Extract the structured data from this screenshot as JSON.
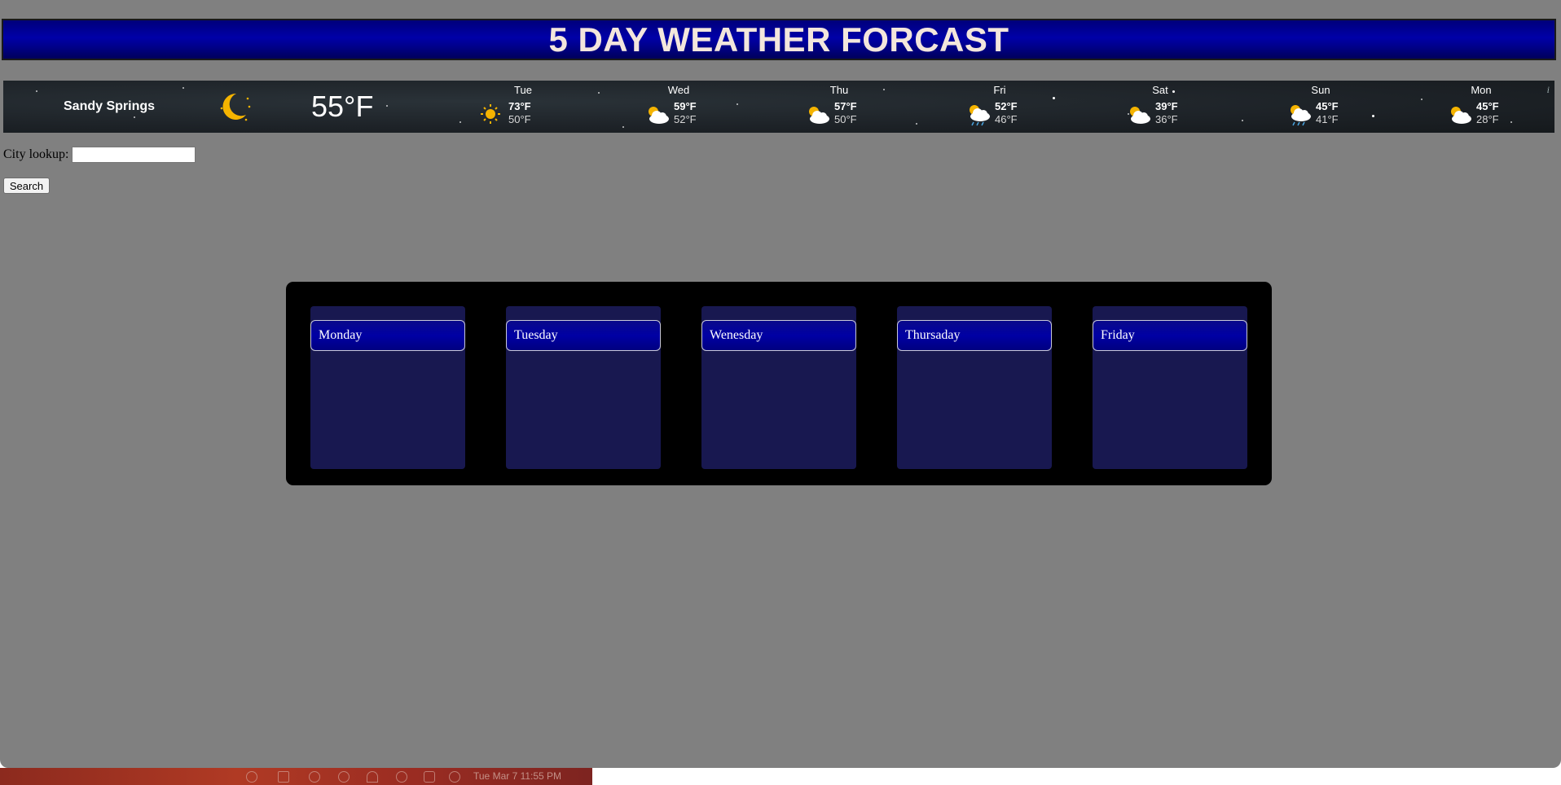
{
  "header": {
    "title": "5 DAY WEATHER FORCAST"
  },
  "widget": {
    "city": "Sandy Springs",
    "current_icon": "moon-icon",
    "current_temp": "55°F",
    "info": "i",
    "days": [
      {
        "name": "Tue",
        "icon": "sun-icon",
        "high": "73°F",
        "low": "50°F"
      },
      {
        "name": "Wed",
        "icon": "partly-cloudy-icon",
        "high": "59°F",
        "low": "52°F"
      },
      {
        "name": "Thu",
        "icon": "partly-cloudy-icon",
        "high": "57°F",
        "low": "50°F"
      },
      {
        "name": "Fri",
        "icon": "rain-icon",
        "high": "52°F",
        "low": "46°F"
      },
      {
        "name": "Sat",
        "icon": "partly-cloudy-icon",
        "high": "39°F",
        "low": "36°F"
      },
      {
        "name": "Sun",
        "icon": "rain-icon",
        "high": "45°F",
        "low": "41°F"
      },
      {
        "name": "Mon",
        "icon": "partly-cloudy-icon",
        "high": "45°F",
        "low": "28°F"
      }
    ]
  },
  "lookup": {
    "label": "City lookup:",
    "value": "",
    "placeholder": ""
  },
  "search": {
    "label": "Search"
  },
  "forecast": {
    "cards": [
      {
        "label": "Monday"
      },
      {
        "label": "Tuesday"
      },
      {
        "label": "Wenesday"
      },
      {
        "label": "Thursaday"
      },
      {
        "label": "Friday"
      }
    ]
  },
  "taskbar": {
    "clock": "Tue Mar 7  11:55 PM"
  },
  "colors": {
    "background": "#808080",
    "header_blue": "#0000a8",
    "card_navy": "#181850",
    "title_text": "#f3e6dc"
  }
}
